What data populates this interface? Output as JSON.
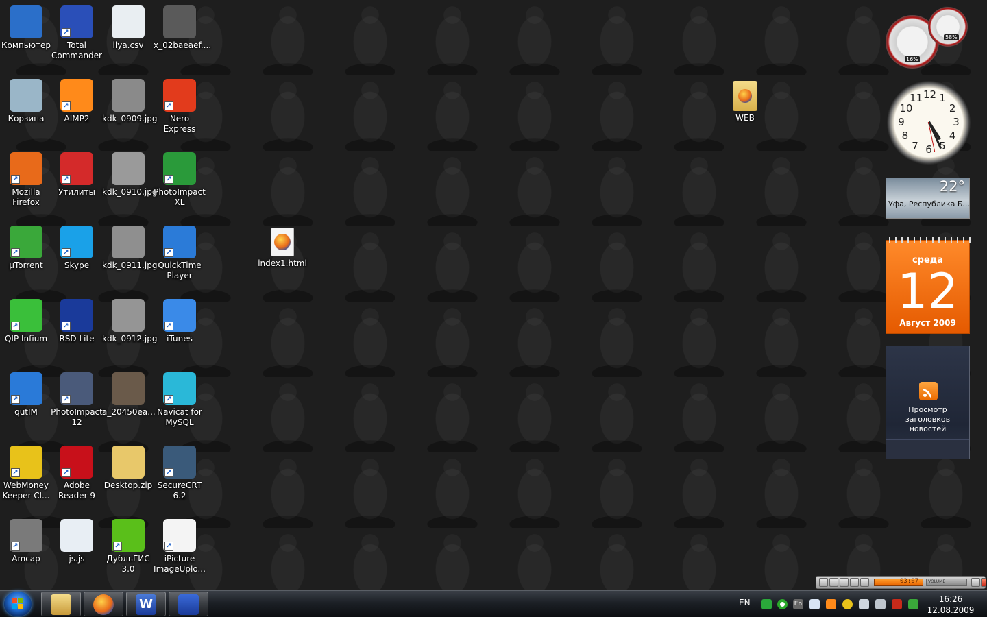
{
  "desktop": {
    "icons": [
      {
        "label": "Компьютер",
        "icon": "computer-icon",
        "color": "#2b6fc9"
      },
      {
        "label": "Total\nCommander",
        "icon": "floppy-icon",
        "color": "#2a4fb8"
      },
      {
        "label": "ilya.csv",
        "icon": "excel-file-icon",
        "color": "#e9eef2"
      },
      {
        "label": "x_02baeaef....",
        "icon": "photo-thumbnail-icon",
        "color": "#5a5a5a"
      },
      {
        "label": "Корзина",
        "icon": "recycle-bin-icon",
        "color": "#9ab6c8"
      },
      {
        "label": "AIMP2",
        "icon": "aimp-icon",
        "color": "#ff8a1a"
      },
      {
        "label": "kdk_0909.jpg",
        "icon": "photo-thumbnail-icon",
        "color": "#8a8a8a"
      },
      {
        "label": "Nero Express",
        "icon": "nero-icon",
        "color": "#e23b1c"
      },
      {
        "label": "Mozilla\nFirefox",
        "icon": "firefox-icon",
        "color": "#e86a1a"
      },
      {
        "label": "Утилиты",
        "icon": "utilities-icon",
        "color": "#d42a2a"
      },
      {
        "label": "kdk_0910.jpg",
        "icon": "photo-thumbnail-icon",
        "color": "#9a9a9a"
      },
      {
        "label": "PhotoImpact\nXL",
        "icon": "photoimpact-xl-icon",
        "color": "#2a9a3a"
      },
      {
        "label": "µTorrent",
        "icon": "utorrent-icon",
        "color": "#3aa83a"
      },
      {
        "label": "Skype",
        "icon": "skype-icon",
        "color": "#1aa1e8"
      },
      {
        "label": "kdk_0911.jpg",
        "icon": "photo-thumbnail-icon",
        "color": "#8f8f8f"
      },
      {
        "label": "QuickTime\nPlayer",
        "icon": "quicktime-icon",
        "color": "#2b7bd8"
      },
      {
        "label": "QIP Infium",
        "icon": "qip-icon",
        "color": "#3abf3a"
      },
      {
        "label": "RSD Lite",
        "icon": "motorola-icon",
        "color": "#1a3a9a"
      },
      {
        "label": "kdk_0912.jpg",
        "icon": "photo-thumbnail-icon",
        "color": "#959595"
      },
      {
        "label": "iTunes",
        "icon": "itunes-icon",
        "color": "#3a8ae8"
      },
      {
        "label": "qutIM",
        "icon": "qutim-icon",
        "color": "#2a7ad8"
      },
      {
        "label": "PhotoImpact\n12",
        "icon": "camera-icon",
        "color": "#4a5a7a"
      },
      {
        "label": "a_20450ea...",
        "icon": "photo-thumbnail-icon",
        "color": "#6a5a4a"
      },
      {
        "label": "Navicat for\nMySQL",
        "icon": "navicat-icon",
        "color": "#2ab8d8"
      },
      {
        "label": "WebMoney\nKeeper Cl...",
        "icon": "webmoney-icon",
        "color": "#e8c21a"
      },
      {
        "label": "Adobe\nReader 9",
        "icon": "adobe-reader-icon",
        "color": "#c8101a"
      },
      {
        "label": "Desktop.zip",
        "icon": "zip-folder-icon",
        "color": "#e8c86a"
      },
      {
        "label": "SecureCRT\n6.2",
        "icon": "securecrt-icon",
        "color": "#3a5a7a"
      },
      {
        "label": "Amcap",
        "icon": "amcap-icon",
        "color": "#7a7a7a"
      },
      {
        "label": "js.js",
        "icon": "script-file-icon",
        "color": "#e8eef4"
      },
      {
        "label": "ДубльГИС\n3.0",
        "icon": "dublgis-icon",
        "color": "#5abf1a"
      },
      {
        "label": "iPicture\nImageUplo...",
        "icon": "ipicture-icon",
        "color": "#f4f4f4"
      }
    ],
    "extra_icons": [
      {
        "label": "index1.html",
        "icon": "html-file-icon",
        "color": "#f4f4f4"
      },
      {
        "label": "WEB",
        "icon": "folder-icon",
        "color": "#e8c86a"
      }
    ]
  },
  "gadgets": {
    "cpu_meter": {
      "cpu": "16%",
      "memory": "58%"
    },
    "clock": {
      "numbers": [
        "12",
        "1",
        "2",
        "3",
        "4",
        "5",
        "6",
        "7",
        "8",
        "9",
        "10",
        "11"
      ]
    },
    "weather": {
      "temperature": "22°",
      "location": "Уфа, Республика Б..."
    },
    "calendar": {
      "weekday": "среда",
      "day": "12",
      "month_year": "Август 2009"
    },
    "news": {
      "text": "Просмотр заголовков новостей"
    }
  },
  "player": {
    "time": "03:07",
    "volume_label": "VOLUME"
  },
  "taskbar": {
    "pinned": [
      {
        "name": "explorer",
        "color": "#e8c86a"
      },
      {
        "name": "firefox",
        "color": "#e86a1a"
      },
      {
        "name": "word",
        "color": "#2a5ab8"
      },
      {
        "name": "total-commander",
        "color": "#2a4fb8"
      }
    ],
    "language": "EN",
    "tray_language_badge": "En",
    "time": "16:26",
    "date": "12.08.2009"
  }
}
